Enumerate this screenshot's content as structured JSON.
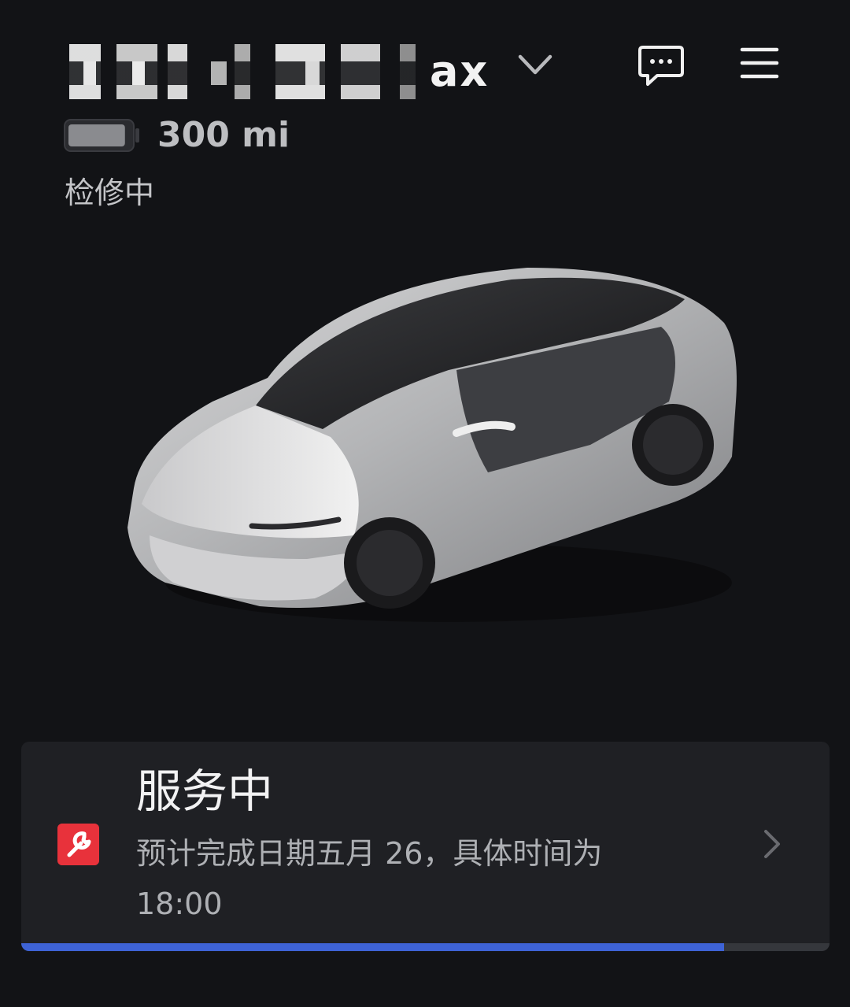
{
  "header": {
    "vehicle_name": "ax",
    "icons": {
      "dropdown": "chevron-down-icon",
      "chat": "chat-bubble-icon",
      "menu": "hamburger-menu-icon"
    }
  },
  "vehicle": {
    "range": "300 mi",
    "status": "检修中",
    "battery_level": 0.92
  },
  "service_card": {
    "title": "服务中",
    "description": "预计完成日期五月 26，具体时间为 18:00",
    "progress": 0.87,
    "icon": "wrench-icon",
    "accent_color": "#e8323b",
    "progress_color": "#3e63d6"
  }
}
